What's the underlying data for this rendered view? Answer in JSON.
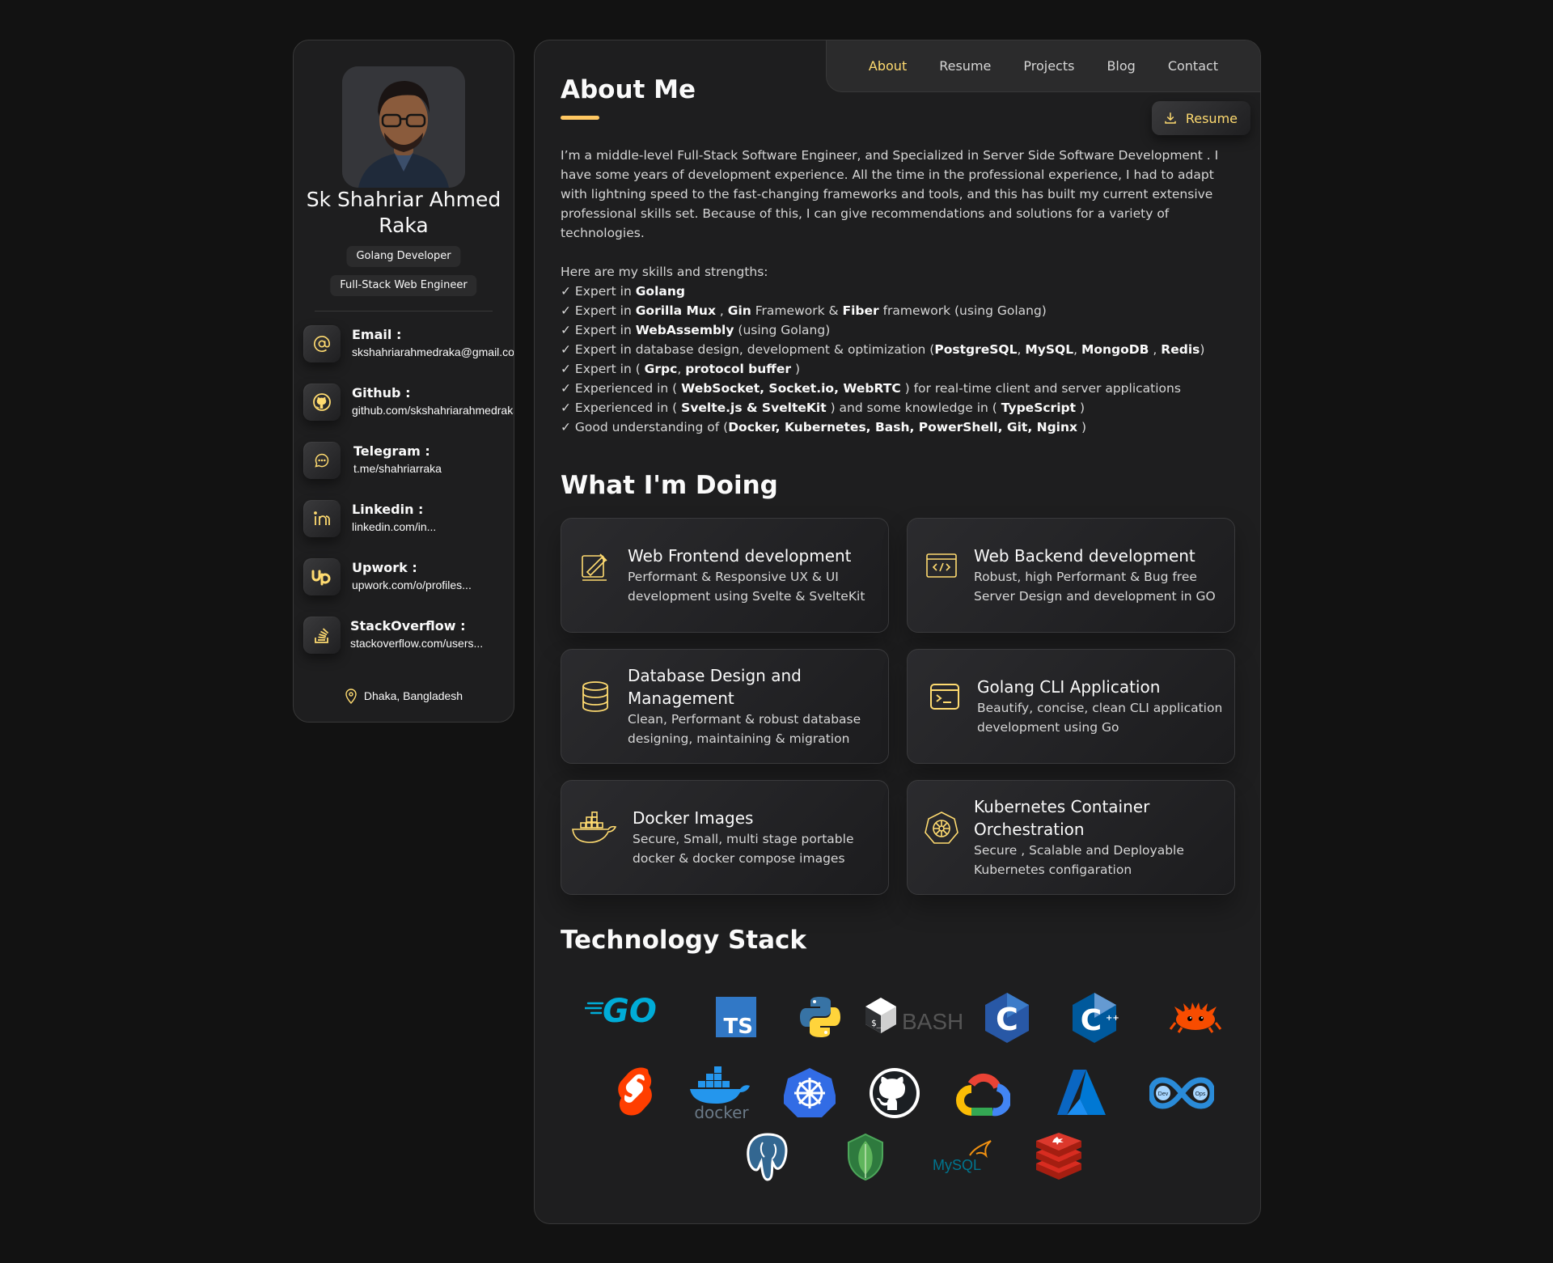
{
  "profile": {
    "name": "Sk Shahriar Ahmed Raka",
    "titles": [
      "Golang Developer",
      "Full-Stack Web Engineer"
    ],
    "contacts": [
      {
        "label": "Email :",
        "value": "skshahriarahmedraka@gmail.com",
        "icon": "at-icon"
      },
      {
        "label": "Github :",
        "value": "github.com/skshahriarahmedraka",
        "icon": "github-icon"
      },
      {
        "label": "Telegram :",
        "value": "t.me/shahriarraka",
        "icon": "telegram-icon"
      },
      {
        "label": "Linkedin :",
        "value": "linkedin.com/in...",
        "icon": "linkedin-icon"
      },
      {
        "label": "Upwork :",
        "value": "upwork.com/o/profiles...",
        "icon": "upwork-icon"
      },
      {
        "label": "StackOverflow :",
        "value": "stackoverflow.com/users...",
        "icon": "stackoverflow-icon"
      }
    ],
    "location": "Dhaka, Bangladesh"
  },
  "nav": {
    "items": [
      "About",
      "Resume",
      "Projects",
      "Blog",
      "Contact"
    ],
    "active": "About"
  },
  "resume_button": "Resume",
  "about": {
    "heading": "About Me",
    "intro": "I’m a middle-level Full-Stack Software Engineer, and Specialized in Server Side Software Development . I have some years of development experience. All the time in the professional experience, I had to adapt with lightning speed to the fast-changing frameworks and tools, and this has built my current extensive professional skills set. Because of this, I can give recommendations and solutions for a variety of technologies.",
    "skills_heading": "Here are my skills and strengths:",
    "skills": [
      "✓ Expert in <b>Golang</b>",
      "✓ Expert in <b>Gorilla Mux</b> , <b>Gin</b> Framework &amp; <b>Fiber</b> framework (using Golang)",
      "✓ Expert in <b>WebAssembly</b> (using Golang)",
      "✓ Expert in database design, development &amp; optimization (<b>PostgreSQL</b>, <b>MySQL</b>, <b>MongoDB</b> , <b>Redis</b>)",
      "✓ Expert in ( <b>Grpc</b>, <b>protocol buffer</b> )",
      "✓ Experienced in ( <b>WebSocket, Socket.io, WebRTC</b> ) for real-time client and server applications",
      "✓ Experienced in ( <b>Svelte.js &amp; SvelteKit</b> ) and some knowledge in ( <b>TypeScript</b> )",
      "✓ Good understanding of (<b>Docker, Kubernetes, Bash, PowerShell, Git, Nginx</b> )"
    ]
  },
  "doing": {
    "heading": "What I'm Doing",
    "services": [
      {
        "title": "Web Frontend development",
        "desc": "Performant & Responsive UX & UI development using Svelte & SvelteKit",
        "icon": "design-icon"
      },
      {
        "title": "Web Backend development",
        "desc": "Robust, high Performant & Bug free Server Design and development in GO",
        "icon": "code-window-icon"
      },
      {
        "title": "Database Design and Management",
        "desc": "Clean, Performant & robust database designing, maintaining & migration",
        "icon": "database-icon"
      },
      {
        "title": "Golang CLI Application",
        "desc": "Beautify, concise, clean CLI application development using Go",
        "icon": "terminal-icon"
      },
      {
        "title": "Docker Images",
        "desc": "Secure, Small, multi stage portable docker & docker compose images",
        "icon": "docker-icon"
      },
      {
        "title": "Kubernetes Container Orchestration",
        "desc": "Secure , Scalable and Deployable Kubernetes configaration",
        "icon": "helm-icon"
      }
    ]
  },
  "tech": {
    "heading": "Technology Stack",
    "logos": [
      {
        "name": "go-logo",
        "text": "GO"
      },
      {
        "name": "typescript-logo",
        "text": "TS"
      },
      {
        "name": "python-logo"
      },
      {
        "name": "bash-logo",
        "text": "BASH"
      },
      {
        "name": "c-logo",
        "text": "C"
      },
      {
        "name": "cpp-logo",
        "text": "C"
      },
      {
        "name": "rust-logo"
      },
      {
        "name": "svelte-logo"
      },
      {
        "name": "docker-logo",
        "text": "docker"
      },
      {
        "name": "kubernetes-logo"
      },
      {
        "name": "github-logo"
      },
      {
        "name": "google-cloud-logo"
      },
      {
        "name": "azure-logo"
      },
      {
        "name": "devops-logo"
      },
      {
        "name": "postgresql-logo"
      },
      {
        "name": "mongodb-logo"
      },
      {
        "name": "mysql-logo",
        "text": "MySQL"
      },
      {
        "name": "redis-logo"
      }
    ]
  },
  "colors": {
    "accent": "#ffdb70",
    "bg": "#121212",
    "card": "#1e1e1f"
  }
}
